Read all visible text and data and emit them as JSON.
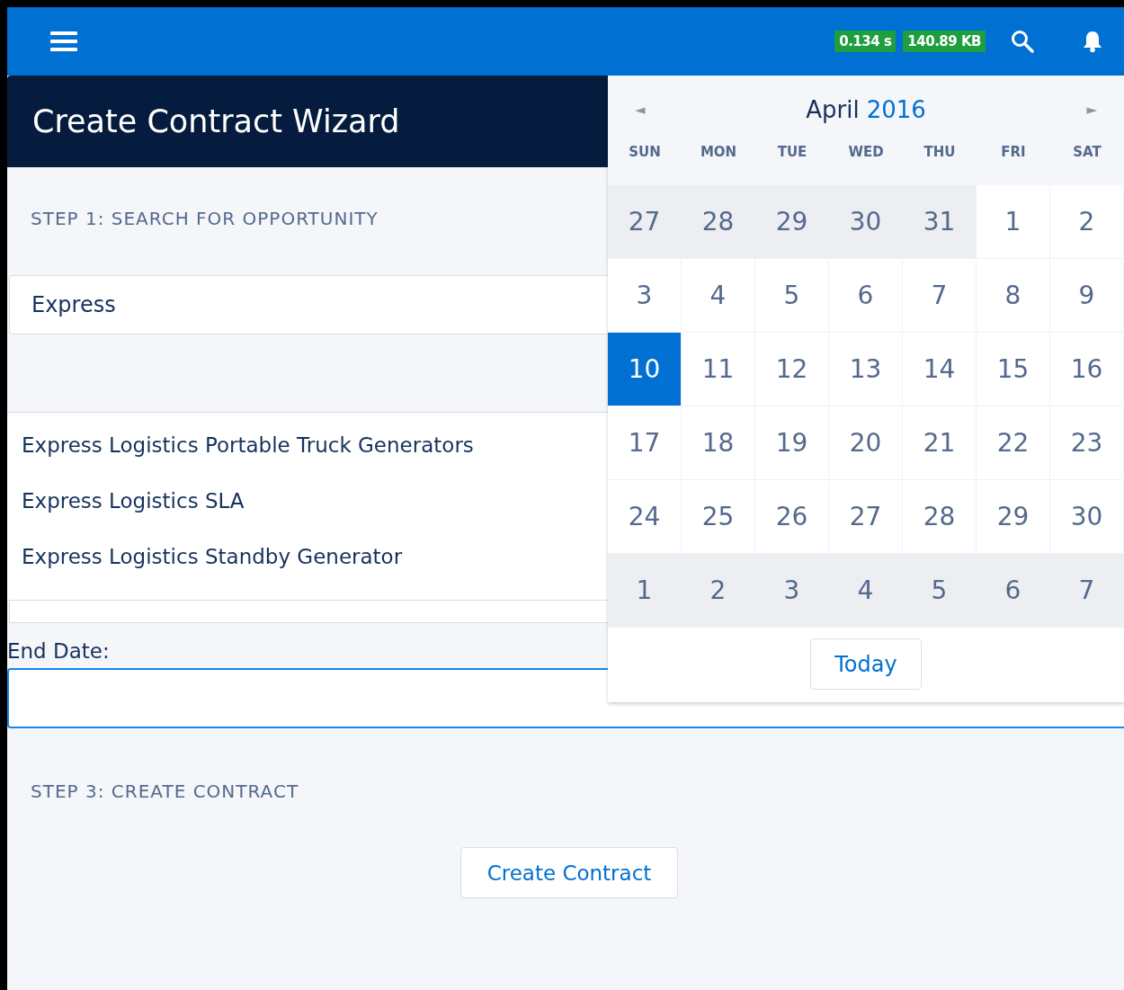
{
  "header": {
    "timing": "0.134 s",
    "size": "140.89 KB"
  },
  "title": "Create Contract Wizard",
  "step1": {
    "label": "STEP 1: SEARCH FOR OPPORTUNITY",
    "search": {
      "value": "Express"
    },
    "results": [
      "Express Logistics Portable Truck Generators",
      "Express Logistics SLA",
      "Express Logistics Standby Generator"
    ]
  },
  "end_date": {
    "label": "End Date:"
  },
  "step3": {
    "label": "STEP 3: CREATE CONTRACT",
    "button": "Create Contract"
  },
  "calendar": {
    "prev": "◄",
    "month": "April",
    "year": "2016",
    "next": "►",
    "weekdays": [
      "SUN",
      "MON",
      "TUE",
      "WED",
      "THU",
      "FRI",
      "SAT"
    ],
    "weeks": [
      [
        {
          "day": "27",
          "outside": true,
          "selected": false
        },
        {
          "day": "28",
          "outside": true,
          "selected": false
        },
        {
          "day": "29",
          "outside": true,
          "selected": false
        },
        {
          "day": "30",
          "outside": true,
          "selected": false
        },
        {
          "day": "31",
          "outside": true,
          "selected": false
        },
        {
          "day": "1",
          "outside": false,
          "selected": false
        },
        {
          "day": "2",
          "outside": false,
          "selected": false
        }
      ],
      [
        {
          "day": "3",
          "outside": false,
          "selected": false
        },
        {
          "day": "4",
          "outside": false,
          "selected": false
        },
        {
          "day": "5",
          "outside": false,
          "selected": false
        },
        {
          "day": "6",
          "outside": false,
          "selected": false
        },
        {
          "day": "7",
          "outside": false,
          "selected": false
        },
        {
          "day": "8",
          "outside": false,
          "selected": false
        },
        {
          "day": "9",
          "outside": false,
          "selected": false
        }
      ],
      [
        {
          "day": "10",
          "outside": false,
          "selected": true
        },
        {
          "day": "11",
          "outside": false,
          "selected": false
        },
        {
          "day": "12",
          "outside": false,
          "selected": false
        },
        {
          "day": "13",
          "outside": false,
          "selected": false
        },
        {
          "day": "14",
          "outside": false,
          "selected": false
        },
        {
          "day": "15",
          "outside": false,
          "selected": false
        },
        {
          "day": "16",
          "outside": false,
          "selected": false
        }
      ],
      [
        {
          "day": "17",
          "outside": false,
          "selected": false
        },
        {
          "day": "18",
          "outside": false,
          "selected": false
        },
        {
          "day": "19",
          "outside": false,
          "selected": false
        },
        {
          "day": "20",
          "outside": false,
          "selected": false
        },
        {
          "day": "21",
          "outside": false,
          "selected": false
        },
        {
          "day": "22",
          "outside": false,
          "selected": false
        },
        {
          "day": "23",
          "outside": false,
          "selected": false
        }
      ],
      [
        {
          "day": "24",
          "outside": false,
          "selected": false
        },
        {
          "day": "25",
          "outside": false,
          "selected": false
        },
        {
          "day": "26",
          "outside": false,
          "selected": false
        },
        {
          "day": "27",
          "outside": false,
          "selected": false
        },
        {
          "day": "28",
          "outside": false,
          "selected": false
        },
        {
          "day": "29",
          "outside": false,
          "selected": false
        },
        {
          "day": "30",
          "outside": false,
          "selected": false
        }
      ],
      [
        {
          "day": "1",
          "outside": true,
          "selected": false
        },
        {
          "day": "2",
          "outside": true,
          "selected": false
        },
        {
          "day": "3",
          "outside": true,
          "selected": false
        },
        {
          "day": "4",
          "outside": true,
          "selected": false
        },
        {
          "day": "5",
          "outside": true,
          "selected": false
        },
        {
          "day": "6",
          "outside": true,
          "selected": false
        },
        {
          "day": "7",
          "outside": true,
          "selected": false
        }
      ]
    ],
    "today": "Today"
  }
}
